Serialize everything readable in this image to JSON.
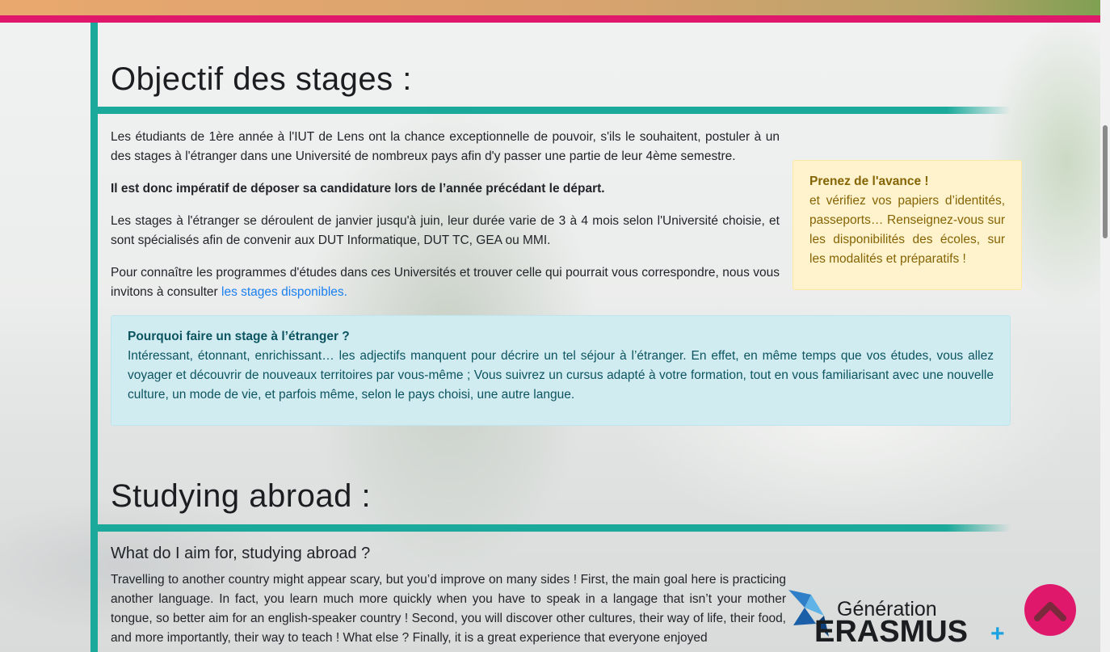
{
  "section1": {
    "title": "Objectif des stages :",
    "p1": "Les étudiants de 1ère année à l'IUT de Lens ont la chance exceptionnelle de pouvoir, s'ils le souhaitent, postuler à un des stages à l'étranger dans une Université de nombreux pays afin d'y passer une partie de leur 4ème semestre.",
    "p2": "Il est donc impératif de déposer sa candidature lors de l’année précédant le départ.",
    "p3": "Les stages à l'étranger se déroulent de janvier jusqu'à juin, leur durée varie de 3 à 4 mois selon l'Université choisie, et sont spécialisés afin de convenir aux DUT Informatique, DUT TC, GEA ou MMI.",
    "p4_text": "Pour connaître les programmes d'études dans ces Universités et trouver celle qui pourrait vous correspondre, nous vous invitons à consulter ",
    "p4_link": "les stages disponibles."
  },
  "warning_box": {
    "title": "Prenez de l'avance !",
    "text": "et vérifiez vos papiers d’identités, passeports… Renseignez-vous sur les disponibilités des écoles, sur les modalités et préparatifs !"
  },
  "info_box": {
    "title": "Pourquoi faire un stage à l’étranger ?",
    "text": "Intéressant, étonnant, enrichissant… les adjectifs manquent pour décrire un tel séjour à l’étranger. En effet, en même temps que vos études, vous allez voyager et découvrir de nouveaux territoires par vous-même ; Vous suivrez un cursus adapté à votre formation, tout en vous familiarisant avec une nouvelle culture, un mode de vie, et parfois même, selon le pays choisi, une autre langue."
  },
  "section2": {
    "title": "Studying abroad :",
    "subtitle": "What do I aim for, studying abroad ?",
    "p1": "Travelling to another country might appear scary, but you’d improve on many sides ! First, the main goal here is practicing another language. In fact, you learn much more quickly when you have to speak in a langage that isn’t your mother tongue, so better aim for an english-speaker country ! Second, you will discover other cultures, their way of life, their food, and more importantly, their way to teach ! What else ? Finally, it is a great experience that everyone enjoyed"
  },
  "logo": {
    "line1": "Génération",
    "line2": "ERASMUS",
    "plus": "+"
  },
  "icons": {
    "back_to_top": "chevron-up-icon"
  },
  "colors": {
    "accent_pink": "#e0186c",
    "accent_teal": "#1aa99a"
  }
}
